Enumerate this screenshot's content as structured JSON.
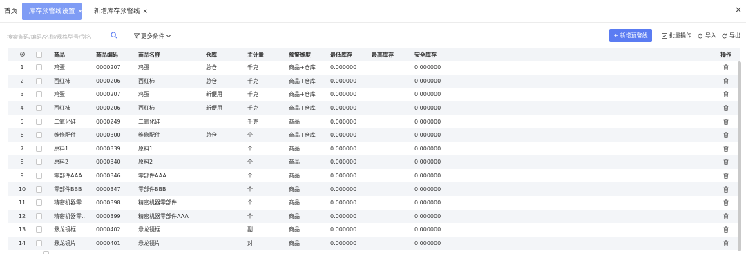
{
  "tabs": {
    "home": "首页",
    "active": "库存预警线设置",
    "second": "新增库存预警线",
    "close_glyph": "×"
  },
  "toolbar": {
    "search_placeholder": "搜索条码/编码/名称/规格型号/别名",
    "more_filters": "更多条件",
    "add_button": "+ 新增预警线",
    "batch": "批量操作",
    "import": "导入",
    "export": "导出"
  },
  "table": {
    "columns": [
      "商品",
      "商品编码",
      "商品名称",
      "仓库",
      "主计量",
      "预警维度",
      "最低库存",
      "最高库存",
      "安全库存",
      "操作"
    ],
    "rows": [
      {
        "idx": "1",
        "product": "鸡蛋",
        "code": "0000207",
        "name": "鸡蛋",
        "warehouse": "总仓",
        "unit": "千克",
        "dimension": "商品+仓库",
        "min": "0.000000",
        "max": "",
        "safe": "0.000000"
      },
      {
        "idx": "2",
        "product": "西红柿",
        "code": "0000206",
        "name": "西红柿",
        "warehouse": "总仓",
        "unit": "千克",
        "dimension": "商品+仓库",
        "min": "0.000000",
        "max": "",
        "safe": "0.000000"
      },
      {
        "idx": "3",
        "product": "鸡蛋",
        "code": "0000207",
        "name": "鸡蛋",
        "warehouse": "新便用",
        "unit": "千克",
        "dimension": "商品+仓库",
        "min": "0.000000",
        "max": "",
        "safe": "0.000000"
      },
      {
        "idx": "4",
        "product": "西红柿",
        "code": "0000206",
        "name": "西红柿",
        "warehouse": "新便用",
        "unit": "千克",
        "dimension": "商品+仓库",
        "min": "0.000000",
        "max": "",
        "safe": "0.000000"
      },
      {
        "idx": "5",
        "product": "二氧化硅",
        "code": "0000249",
        "name": "二氧化硅",
        "warehouse": "",
        "unit": "千克",
        "dimension": "商品",
        "min": "0.000000",
        "max": "",
        "safe": "0.000000"
      },
      {
        "idx": "6",
        "product": "维修配件",
        "code": "0000300",
        "name": "维修配件",
        "warehouse": "总仓",
        "unit": "个",
        "dimension": "商品+仓库",
        "min": "0.000000",
        "max": "",
        "safe": "0.000000"
      },
      {
        "idx": "7",
        "product": "原料1",
        "code": "0000339",
        "name": "原料1",
        "warehouse": "",
        "unit": "个",
        "dimension": "商品",
        "min": "0.000000",
        "max": "",
        "safe": "0.000000"
      },
      {
        "idx": "8",
        "product": "原料2",
        "code": "0000340",
        "name": "原料2",
        "warehouse": "",
        "unit": "个",
        "dimension": "商品",
        "min": "0.000000",
        "max": "",
        "safe": "0.000000"
      },
      {
        "idx": "9",
        "product": "零部件AAA",
        "code": "0000346",
        "name": "零部件AAA",
        "warehouse": "",
        "unit": "个",
        "dimension": "商品",
        "min": "0.000000",
        "max": "",
        "safe": "0.000000"
      },
      {
        "idx": "10",
        "product": "零部件BBB",
        "code": "0000347",
        "name": "零部件BBB",
        "warehouse": "",
        "unit": "个",
        "dimension": "商品",
        "min": "0.000000",
        "max": "",
        "safe": "0.000000"
      },
      {
        "idx": "11",
        "product": "精密机器零...",
        "code": "0000398",
        "name": "精密机器零部件",
        "warehouse": "",
        "unit": "个",
        "dimension": "商品",
        "min": "0.000000",
        "max": "",
        "safe": "0.000000"
      },
      {
        "idx": "12",
        "product": "精密机器零...",
        "code": "0000399",
        "name": "精密机器零部件AAA",
        "warehouse": "",
        "unit": "个",
        "dimension": "商品",
        "min": "0.000000",
        "max": "",
        "safe": "0.000000"
      },
      {
        "idx": "13",
        "product": "悬龙镜框",
        "code": "0000402",
        "name": "悬龙镜框",
        "warehouse": "",
        "unit": "副",
        "dimension": "商品",
        "min": "0.000000",
        "max": "",
        "safe": "0.000000"
      },
      {
        "idx": "14",
        "product": "悬龙镜片",
        "code": "0000401",
        "name": "悬龙镜片",
        "warehouse": "",
        "unit": "对",
        "dimension": "商品",
        "min": "0.000000",
        "max": "",
        "safe": "0.000000"
      }
    ]
  },
  "colors": {
    "active_tab": "#7f9cf5",
    "primary_button": "#5b7cf2",
    "header_bg": "#f2f4f7",
    "stripe_bg": "#f3f5f8"
  },
  "icons": {
    "settings": "gear-icon",
    "search": "search-icon",
    "filter": "filter-icon",
    "delete": "trash-icon"
  }
}
